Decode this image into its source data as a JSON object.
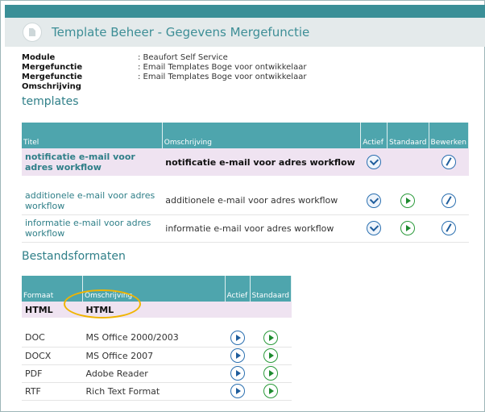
{
  "window": {
    "title": "Template Beheer - Gegevens Mergefunctie"
  },
  "info": [
    {
      "label": "Module",
      "value": ": Beaufort Self Service"
    },
    {
      "label": "Mergefunctie",
      "value": ": Email Templates Boge voor ontwikkelaar"
    },
    {
      "label": "Mergefunctie Omschrijving",
      "value": ": Email Templates Boge voor ontwikkelaar"
    }
  ],
  "templates": {
    "section_title": "templates",
    "headers": {
      "titel": "Titel",
      "omschrijving": "Omschrijving",
      "actief": "Actief",
      "standaard": "Standaard",
      "bewerken": "Bewerken"
    },
    "rows": [
      {
        "titel": "notificatie e-mail voor adres workflow",
        "omschrijving": "notificatie e-mail voor adres workflow"
      },
      {
        "titel": "additionele e-mail voor adres workflow",
        "omschrijving": "additionele e-mail voor adres workflow"
      },
      {
        "titel": "informatie e-mail voor adres workflow",
        "omschrijving": "informatie e-mail voor adres workflow"
      }
    ]
  },
  "formats": {
    "section_title": "Bestandsformaten",
    "headers": {
      "formaat": "Formaat",
      "omschrijving": "Omschrijving",
      "actief": "Actief",
      "standaard": "Standaard"
    },
    "rows": [
      {
        "formaat": "HTML",
        "omschrijving": "HTML"
      },
      {
        "formaat": "DOC",
        "omschrijving": "MS Office 2000/2003"
      },
      {
        "formaat": "DOCX",
        "omschrijving": "MS Office 2007"
      },
      {
        "formaat": "PDF",
        "omschrijving": "Adobe Reader"
      },
      {
        "formaat": "RTF",
        "omschrijving": "Rich Text Format"
      }
    ]
  },
  "icons": {
    "app": "document-icon",
    "actief": "check-icon",
    "standaard": "play-icon",
    "bewerken": "edit-icon"
  },
  "colors": {
    "accent": "#4ea5ad",
    "title": "#3d8e96",
    "selected_row": "#efe3f1",
    "highlight_ring": "#f0b400"
  }
}
